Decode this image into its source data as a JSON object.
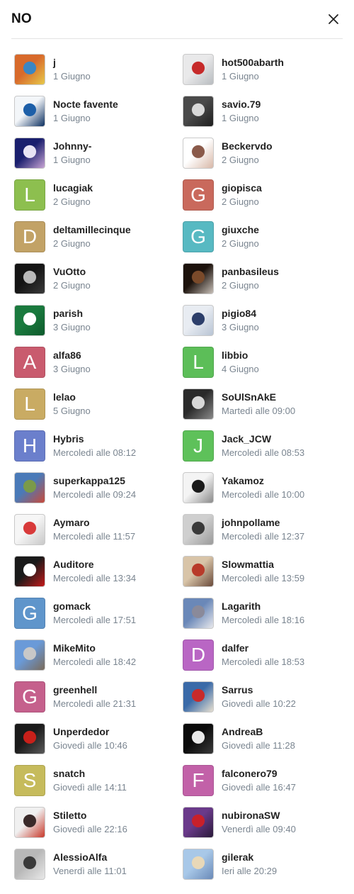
{
  "dialog": {
    "title": "NO",
    "close_icon": "close-icon"
  },
  "voters": [
    {
      "name": "j",
      "date": "1 Giugno",
      "avatar": {
        "kind": "photo",
        "colors": [
          "#d86a2b",
          "#3b86c4",
          "#e7c94a"
        ]
      }
    },
    {
      "name": "hot500abarth",
      "date": "1 Giugno",
      "avatar": {
        "kind": "photo",
        "colors": [
          "#e9e9ea",
          "#c62a2a",
          "#b8bcc0"
        ]
      }
    },
    {
      "name": "Nocte favente",
      "date": "1 Giugno",
      "avatar": {
        "kind": "photo",
        "colors": [
          "#f3f6f9",
          "#1d5fa8",
          "#0b2f60"
        ]
      }
    },
    {
      "name": "savio.79",
      "date": "1 Giugno",
      "avatar": {
        "kind": "photo",
        "colors": [
          "#4a4a4a",
          "#d9d9d9",
          "#1e1e1e"
        ]
      }
    },
    {
      "name": "Johnny-",
      "date": "1 Giugno",
      "avatar": {
        "kind": "photo",
        "colors": [
          "#1a1f6e",
          "#e8e4f4",
          "#c8a4d4"
        ]
      }
    },
    {
      "name": "Beckervdo",
      "date": "2 Giugno",
      "avatar": {
        "kind": "photo",
        "colors": [
          "#ffffff",
          "#8a5a4a",
          "#d8b8a8"
        ]
      }
    },
    {
      "name": "lucagiak",
      "date": "2 Giugno",
      "avatar": {
        "kind": "letter",
        "letter": "L",
        "color": "#8dbf4f"
      }
    },
    {
      "name": "giopisca",
      "date": "2 Giugno",
      "avatar": {
        "kind": "letter",
        "letter": "G",
        "color": "#c9695c"
      }
    },
    {
      "name": "deltamillecinque",
      "date": "2 Giugno",
      "avatar": {
        "kind": "letter",
        "letter": "D",
        "color": "#c2a266"
      }
    },
    {
      "name": "giuxche",
      "date": "2 Giugno",
      "avatar": {
        "kind": "letter",
        "letter": "G",
        "color": "#57b9c2"
      }
    },
    {
      "name": "VuOtto",
      "date": "2 Giugno",
      "avatar": {
        "kind": "photo",
        "colors": [
          "#141414",
          "#b9b9b9",
          "#3a3a3a"
        ]
      }
    },
    {
      "name": "panbasileus",
      "date": "2 Giugno",
      "avatar": {
        "kind": "photo",
        "colors": [
          "#1c120c",
          "#7a4a2a",
          "#c8c0b8"
        ]
      }
    },
    {
      "name": "parish",
      "date": "3 Giugno",
      "avatar": {
        "kind": "photo",
        "colors": [
          "#1a7a3e",
          "#ffffff",
          "#0e5a2c"
        ]
      }
    },
    {
      "name": "pigio84",
      "date": "3 Giugno",
      "avatar": {
        "kind": "photo",
        "colors": [
          "#e8ecf2",
          "#2c3e6a",
          "#b8c4d4"
        ]
      }
    },
    {
      "name": "alfa86",
      "date": "3 Giugno",
      "avatar": {
        "kind": "letter",
        "letter": "A",
        "color": "#c95b6e"
      }
    },
    {
      "name": "libbio",
      "date": "4 Giugno",
      "avatar": {
        "kind": "letter",
        "letter": "L",
        "color": "#5cbe58"
      }
    },
    {
      "name": "lelao",
      "date": "5 Giugno",
      "avatar": {
        "kind": "letter",
        "letter": "L",
        "color": "#c9ab63"
      }
    },
    {
      "name": "SoUlSnAkE",
      "date": "Martedì alle 09:00",
      "avatar": {
        "kind": "photo",
        "colors": [
          "#2a2a2a",
          "#d8d8d8",
          "#8a8a8a"
        ]
      }
    },
    {
      "name": "Hybris",
      "date": "Mercoledì alle 08:12",
      "avatar": {
        "kind": "letter",
        "letter": "H",
        "color": "#6b7fcc"
      }
    },
    {
      "name": "Jack_JCW",
      "date": "Mercoledì alle 08:53",
      "avatar": {
        "kind": "letter",
        "letter": "J",
        "color": "#5ec15a"
      }
    },
    {
      "name": "superkappa125",
      "date": "Mercoledì alle 09:24",
      "avatar": {
        "kind": "photo",
        "colors": [
          "#4a7ab8",
          "#7a9a4a",
          "#c84a3a"
        ]
      }
    },
    {
      "name": "Yakamoz",
      "date": "Mercoledì alle 10:00",
      "avatar": {
        "kind": "photo",
        "colors": [
          "#f4f4f4",
          "#1a1a1a",
          "#8a8a8a"
        ]
      }
    },
    {
      "name": "Aymaro",
      "date": "Mercoledì alle 11:57",
      "avatar": {
        "kind": "photo",
        "colors": [
          "#f6f6f6",
          "#d83a3a",
          "#c8c8c8"
        ]
      }
    },
    {
      "name": "johnpollame",
      "date": "Mercoledì alle 12:37",
      "avatar": {
        "kind": "photo",
        "colors": [
          "#cfcfcf",
          "#3a3a3a",
          "#9a9a9a"
        ]
      }
    },
    {
      "name": "Auditore",
      "date": "Mercoledì alle 13:34",
      "avatar": {
        "kind": "photo",
        "colors": [
          "#1a1a1a",
          "#ffffff",
          "#c41a1a"
        ]
      }
    },
    {
      "name": "Slowmattia",
      "date": "Mercoledì alle 13:59",
      "avatar": {
        "kind": "photo",
        "colors": [
          "#d8c4a8",
          "#b83a2a",
          "#6a4a3a"
        ]
      }
    },
    {
      "name": "gomack",
      "date": "Mercoledì alle 17:51",
      "avatar": {
        "kind": "letter",
        "letter": "G",
        "color": "#5f95cb"
      }
    },
    {
      "name": "Lagarith",
      "date": "Mercoledì alle 18:16",
      "avatar": {
        "kind": "photo",
        "colors": [
          "#6a88b8",
          "#8a8a9a",
          "#e8e8ec"
        ]
      }
    },
    {
      "name": "MikeMito",
      "date": "Mercoledì alle 18:42",
      "avatar": {
        "kind": "photo",
        "colors": [
          "#6a9ad8",
          "#c8c8c8",
          "#7a6a5a"
        ]
      }
    },
    {
      "name": "dalfer",
      "date": "Mercoledì alle 18:53",
      "avatar": {
        "kind": "letter",
        "letter": "D",
        "color": "#b966c4"
      }
    },
    {
      "name": "greenhell",
      "date": "Mercoledì alle 21:31",
      "avatar": {
        "kind": "letter",
        "letter": "G",
        "color": "#c5608c"
      }
    },
    {
      "name": "Sarrus",
      "date": "Giovedì alle 10:22",
      "avatar": {
        "kind": "photo",
        "colors": [
          "#3a6aa8",
          "#c82a2a",
          "#e8e0d0"
        ]
      }
    },
    {
      "name": "Unperdedor",
      "date": "Giovedì alle 10:46",
      "avatar": {
        "kind": "photo",
        "colors": [
          "#1a1a1a",
          "#c8201a",
          "#5a5a5a"
        ]
      }
    },
    {
      "name": "AndreaB",
      "date": "Giovedì alle 11:28",
      "avatar": {
        "kind": "photo",
        "colors": [
          "#0a0a0a",
          "#e8e8e8",
          "#3a3a3a"
        ]
      }
    },
    {
      "name": "snatch",
      "date": "Giovedì alle 14:11",
      "avatar": {
        "kind": "letter",
        "letter": "S",
        "color": "#c6bb5c"
      }
    },
    {
      "name": "falconero79",
      "date": "Giovedì alle 16:47",
      "avatar": {
        "kind": "letter",
        "letter": "F",
        "color": "#c261a8"
      }
    },
    {
      "name": "Stiletto",
      "date": "Giovedì alle 22:16",
      "avatar": {
        "kind": "photo",
        "colors": [
          "#f0f0f0",
          "#3a2a2a",
          "#c8382a"
        ]
      }
    },
    {
      "name": "nubironaSW",
      "date": "Venerdì alle 09:40",
      "avatar": {
        "kind": "photo",
        "colors": [
          "#6a3a8a",
          "#c8202a",
          "#2a1a3a"
        ]
      }
    },
    {
      "name": "AlessioAlfa",
      "date": "Venerdì alle 11:01",
      "avatar": {
        "kind": "photo",
        "colors": [
          "#b8b8b8",
          "#3a3a3a",
          "#e8e8e8"
        ]
      }
    },
    {
      "name": "gilerak",
      "date": "Ieri alle 20:29",
      "avatar": {
        "kind": "photo",
        "colors": [
          "#a8c8e8",
          "#e8d8b8",
          "#6a8ab8"
        ]
      }
    }
  ]
}
